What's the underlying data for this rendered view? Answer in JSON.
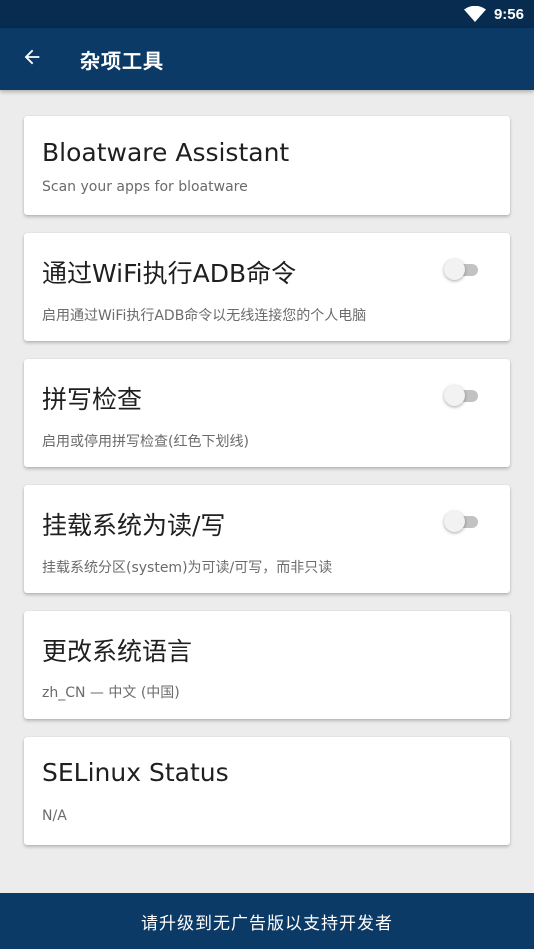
{
  "status_bar": {
    "time": "9:56",
    "wifi_icon": "wifi-icon"
  },
  "app_bar": {
    "title": "杂项工具",
    "back_icon": "arrow-left-icon"
  },
  "cards": [
    {
      "title": "Bloatware Assistant",
      "subtitle": "Scan your apps for bloatware",
      "has_switch": false
    },
    {
      "title": "通过WiFi执行ADB命令",
      "subtitle": "启用通过WiFi执行ADB命令以无线连接您的个人电脑",
      "has_switch": true,
      "switch_on": false
    },
    {
      "title": "拼写检查",
      "subtitle": "启用或停用拼写检查(红色下划线)",
      "has_switch": true,
      "switch_on": false
    },
    {
      "title": "挂载系统为读/写",
      "subtitle": "挂载系统分区(system)为可读/可写，而非只读",
      "has_switch": true,
      "switch_on": false
    },
    {
      "title": "更改系统语言",
      "subtitle": "zh_CN — 中文 (中国)",
      "has_switch": false
    },
    {
      "title": "SELinux Status",
      "subtitle": "N/A",
      "has_switch": false
    }
  ],
  "bottom_bar": {
    "label": "请升级到无广告版以支持开发者"
  },
  "colors": {
    "primary": "#0b3a66",
    "status_bar": "#072c4f",
    "background": "#ececec"
  }
}
